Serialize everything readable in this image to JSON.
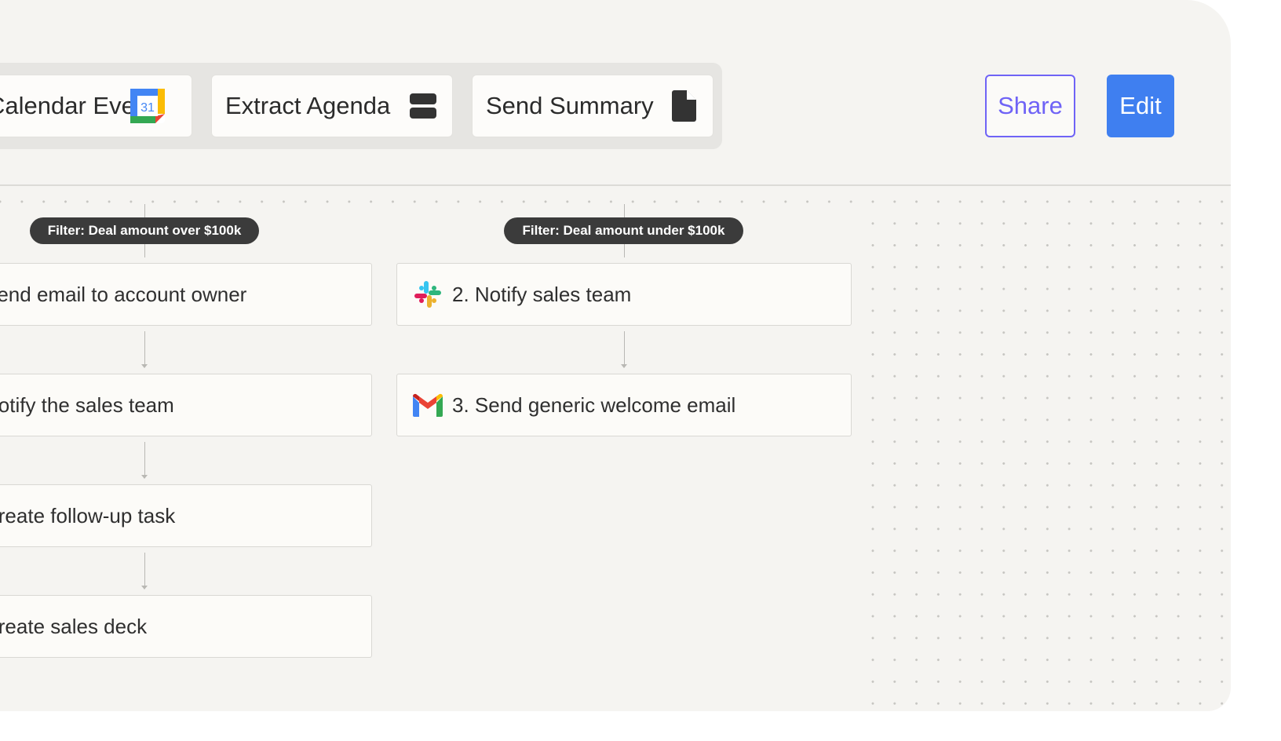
{
  "steps": [
    {
      "label": "Calendar Event",
      "icon": "google-calendar-icon",
      "icon_text": "31"
    },
    {
      "label": "Extract Agenda",
      "icon": "database-icon"
    },
    {
      "label": "Send Summary",
      "icon": "file-icon"
    }
  ],
  "actions": {
    "share_label": "Share",
    "edit_label": "Edit"
  },
  "filters": {
    "left": "Filter: Deal amount over $100k",
    "right": "Filter: Deal amount under $100k"
  },
  "left_branch": [
    {
      "label": "Send email to account owner"
    },
    {
      "label": "Notify the sales team"
    },
    {
      "label": "Create follow-up task"
    },
    {
      "label": "Create sales deck"
    }
  ],
  "right_branch": [
    {
      "label": "2. Notify sales team",
      "icon": "slack-icon"
    },
    {
      "label": "3. Send generic welcome email",
      "icon": "gmail-icon"
    }
  ],
  "colors": {
    "share_accent": "#6f63f6",
    "edit_bg": "#3f7ff0",
    "filter_bg": "#3b3b3b",
    "canvas_bg": "#f5f4f1"
  }
}
